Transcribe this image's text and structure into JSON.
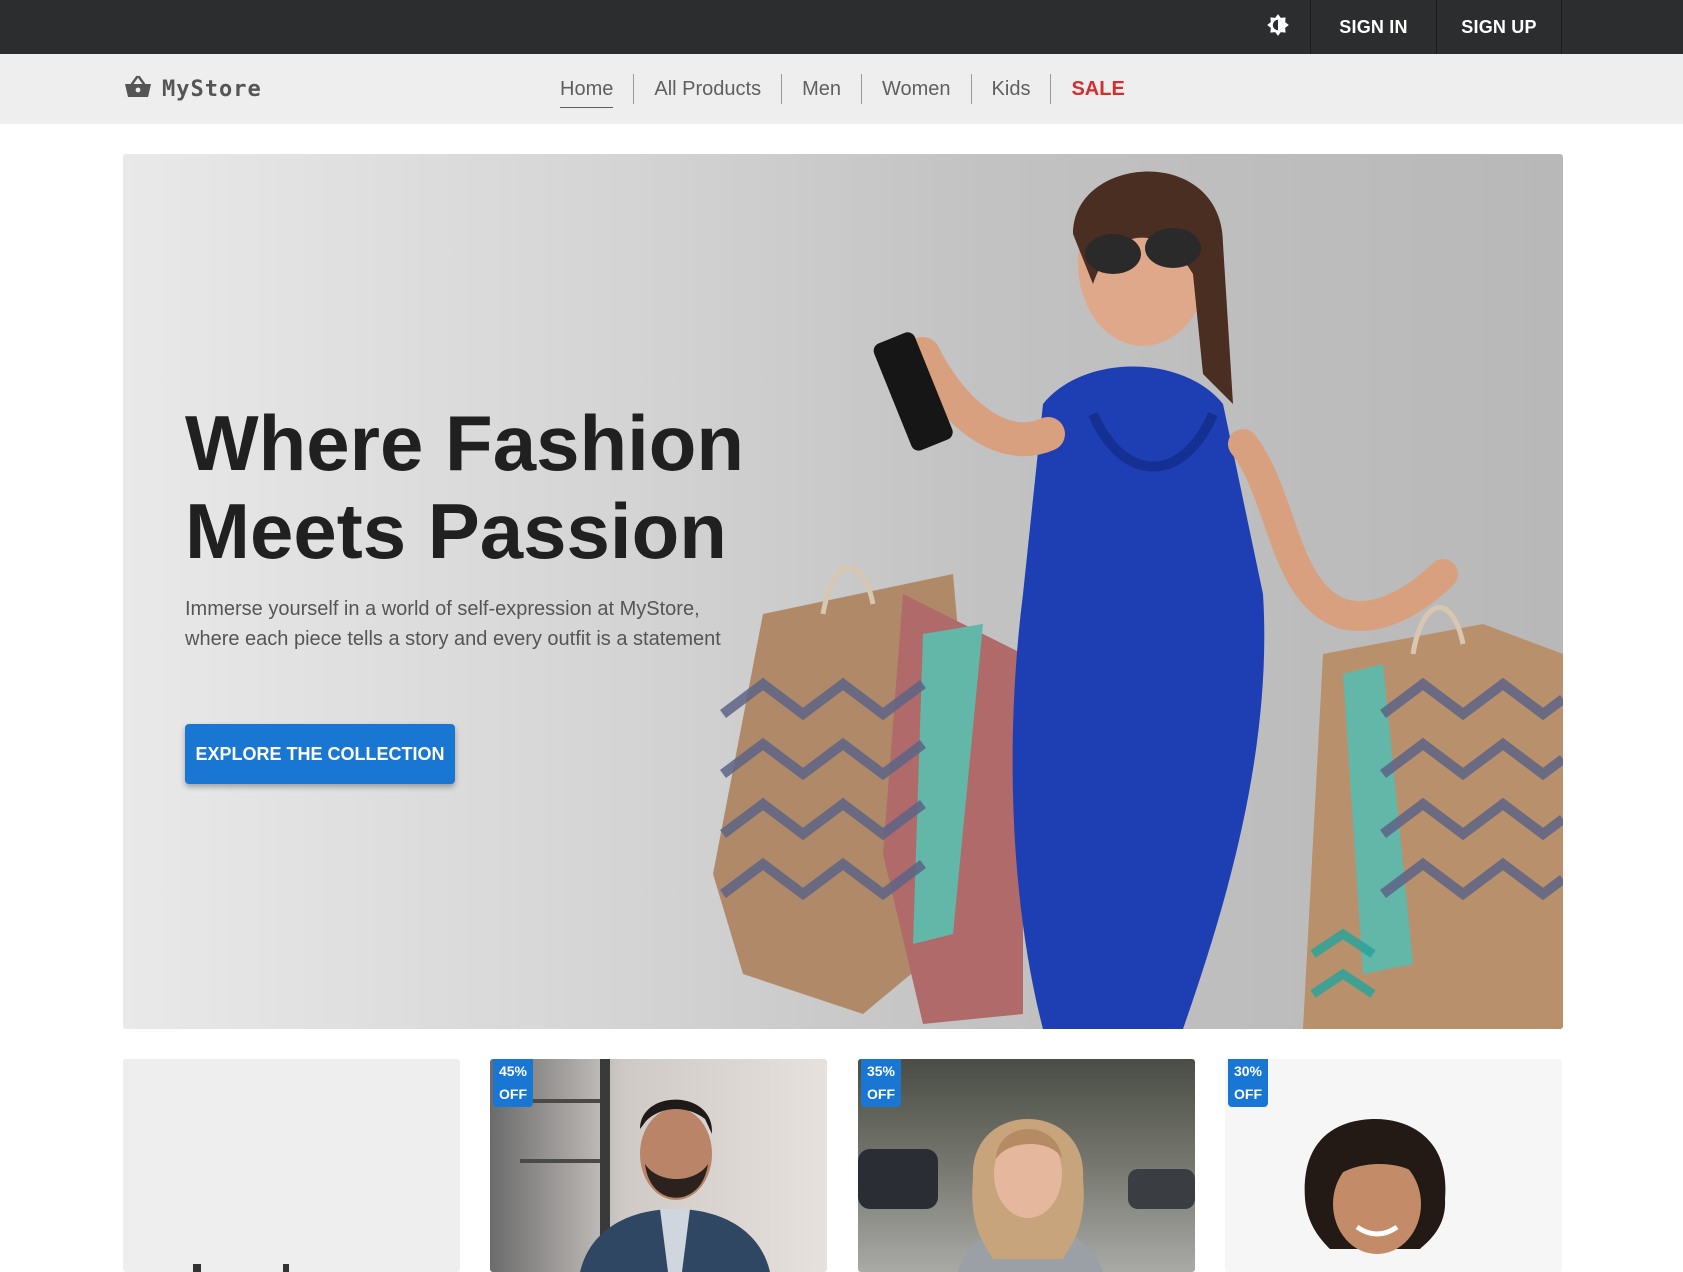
{
  "topbar": {
    "theme_toggle_icon": "brightness-icon",
    "sign_in": "SIGN IN",
    "sign_up": "SIGN UP"
  },
  "navbar": {
    "logo_icon": "shopping-basket-icon",
    "logo_text": "MyStore",
    "links": [
      {
        "label": "Home",
        "active": true
      },
      {
        "label": "All Products"
      },
      {
        "label": "Men"
      },
      {
        "label": "Women"
      },
      {
        "label": "Kids"
      },
      {
        "label": "SALE",
        "color": "#d32f2f"
      }
    ]
  },
  "hero": {
    "title_line1": "Where Fashion",
    "title_line2": "Meets Passion",
    "subtitle": "Immerse yourself in a world of self-expression at MyStore, where each piece tells a story and every outfit is a statement",
    "cta": "EXPLORE THE COLLECTION",
    "image_icon": "woman-shopping-bags-image"
  },
  "cards": [
    {
      "badge_pct": "",
      "badge_off": "",
      "image": "placeholder"
    },
    {
      "badge_pct": "45%",
      "badge_off": "OFF",
      "image": "man-suit-image"
    },
    {
      "badge_pct": "35%",
      "badge_off": "OFF",
      "image": "woman-coat-image"
    },
    {
      "badge_pct": "30%",
      "badge_off": "OFF",
      "image": "child-image"
    }
  ],
  "colors": {
    "topbar_bg": "#2b2d2e",
    "navbar_bg": "#eeeeee",
    "accent": "#1976d2",
    "sale": "#d32f2f"
  }
}
